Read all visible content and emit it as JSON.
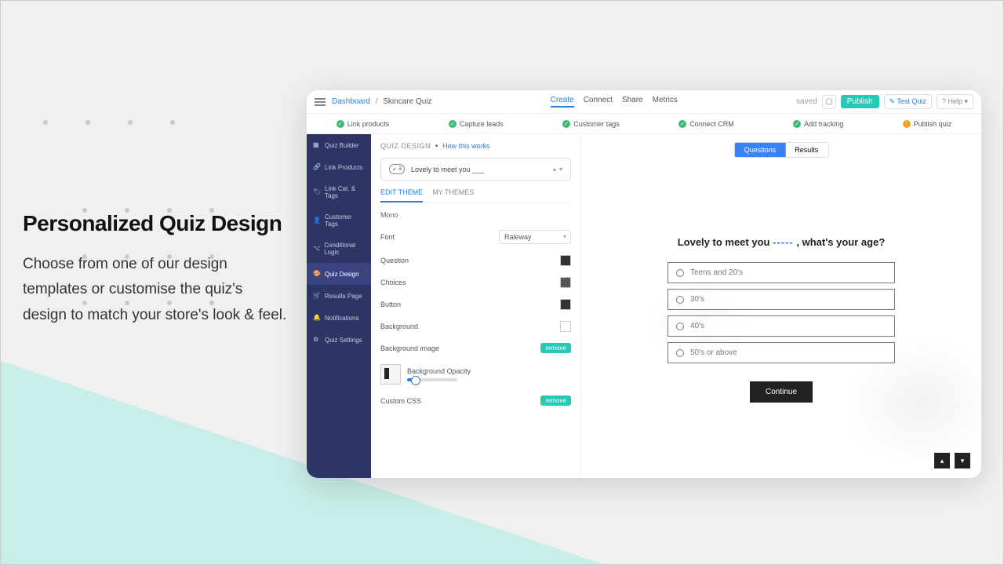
{
  "marketing": {
    "title": "Personalized Quiz Design",
    "body": "Choose from one of our design templates or customise the quiz's design to match your store's look & feel."
  },
  "breadcrumb": {
    "root": "Dashboard",
    "current": "Skincare Quiz"
  },
  "topnav": {
    "create": "Create",
    "connect": "Connect",
    "share": "Share",
    "metrics": "Metrics"
  },
  "topbar": {
    "saved": "saved",
    "publish": "Publish",
    "test_quiz": "Test Quiz",
    "help": "Help"
  },
  "steps": {
    "link_products": "Link products",
    "capture_leads": "Capture leads",
    "customer_tags": "Customer tags",
    "connect_crm": "Connect CRM",
    "add_tracking": "Add tracking",
    "publish_quiz": "Publish quiz"
  },
  "sidebar": {
    "quiz_builder": "Quiz Builder",
    "link_products": "Link Products",
    "link_cat_tags": "Link Cat. & Tags",
    "customer_tags": "Customer Tags",
    "conditional_logic": "Conditional Logic",
    "quiz_design": "Quiz Design",
    "results_page": "Results Page",
    "notifications": "Notifications",
    "quiz_settings": "Quiz Settings"
  },
  "mid": {
    "header_label": "QUIZ DESIGN",
    "how_link": "How this works",
    "question_pill_num": "3",
    "question_text": "Lovely to meet you ___",
    "tabs": {
      "edit": "EDIT THEME",
      "my": "MY THEMES"
    },
    "mono": "Mono",
    "font_label": "Font",
    "font_value": "Raleway",
    "question_label": "Question",
    "choices_label": "Choices",
    "button_label": "Button",
    "background_label": "Background",
    "background_image_label": "Background image",
    "bg_opacity_label": "Background Opacity",
    "custom_css_label": "Custom CSS",
    "remove": "remove"
  },
  "viewtabs": {
    "questions": "Questions",
    "results": "Results"
  },
  "quiz": {
    "heading_pre": "Lovely to meet you ",
    "heading_blank": "-----",
    "heading_post": " , what's your age?",
    "options": [
      "Teens and 20's",
      "30's",
      "40's",
      "50's or above"
    ],
    "continue": "Continue"
  }
}
